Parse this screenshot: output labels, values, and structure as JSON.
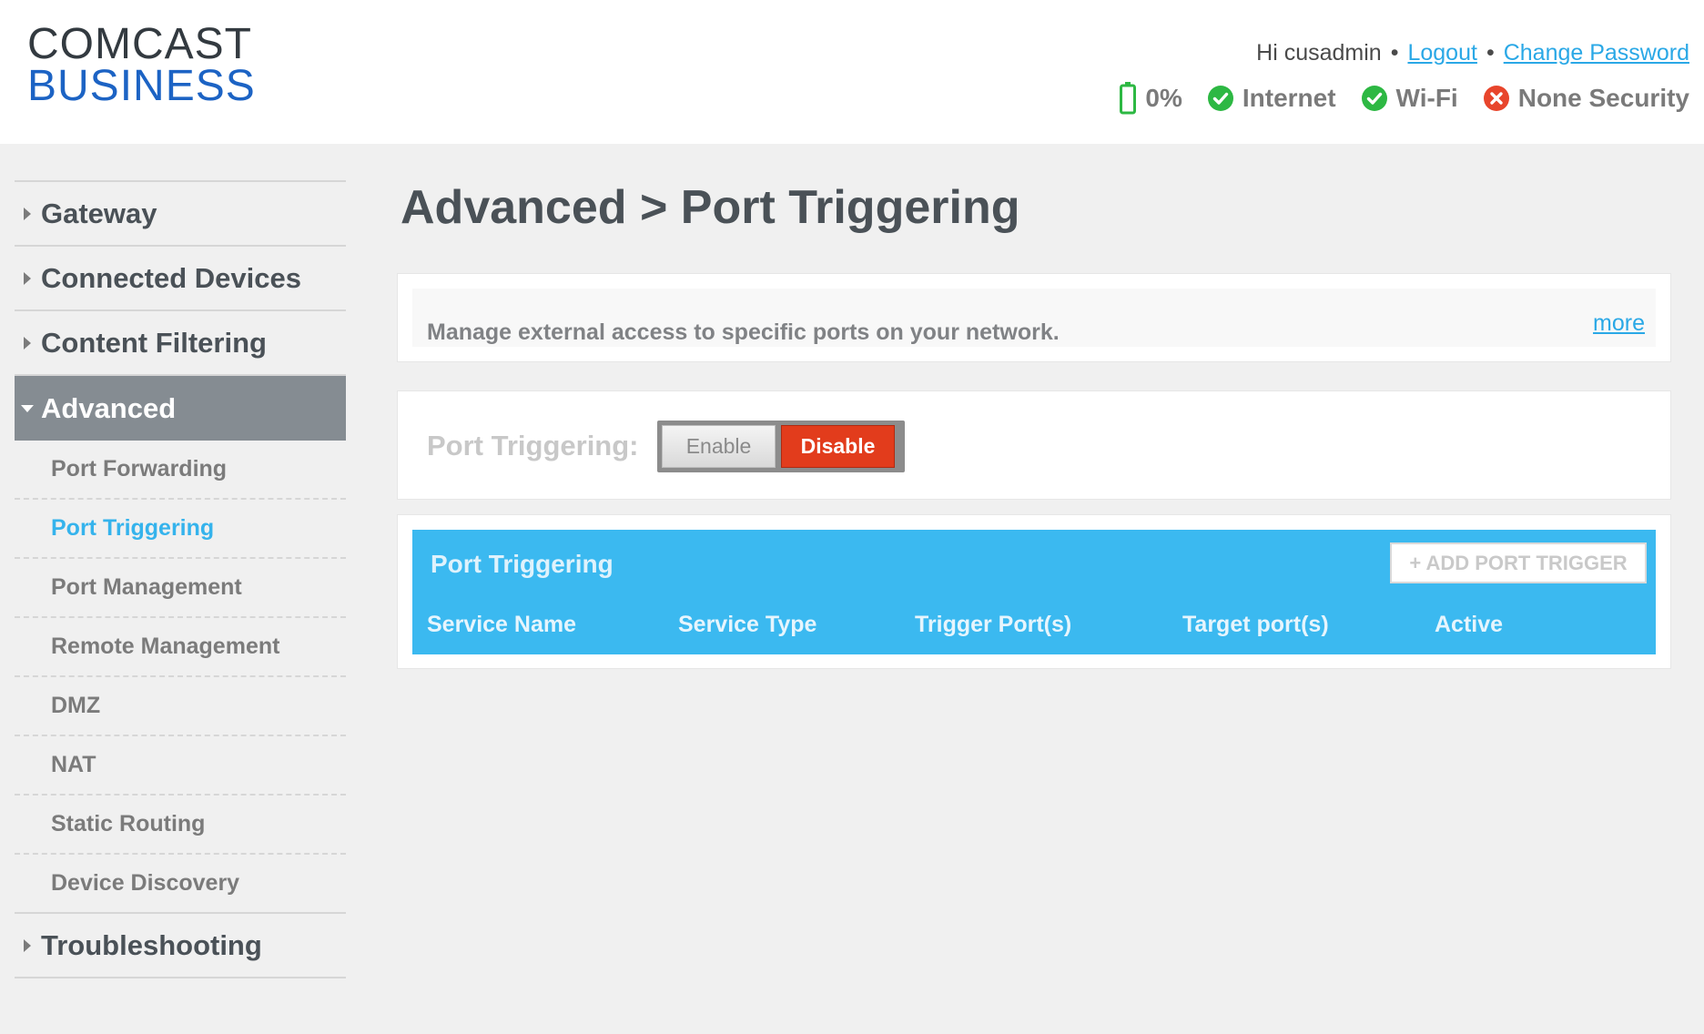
{
  "header": {
    "logo_line1": "COMCAST",
    "logo_line2": "BUSINESS",
    "greeting": "Hi cusadmin",
    "separator": "•",
    "logout_label": "Logout",
    "change_password_label": "Change Password",
    "status": {
      "battery_label": "0%",
      "internet_label": "Internet",
      "wifi_label": "Wi-Fi",
      "security_label": "None Security"
    }
  },
  "sidebar": {
    "items": [
      {
        "label": "Gateway"
      },
      {
        "label": "Connected Devices"
      },
      {
        "label": "Content Filtering"
      },
      {
        "label": "Advanced"
      },
      {
        "label": "Troubleshooting"
      }
    ],
    "advanced_subitems": [
      {
        "label": "Port Forwarding"
      },
      {
        "label": "Port Triggering"
      },
      {
        "label": "Port Management"
      },
      {
        "label": "Remote Management"
      },
      {
        "label": "DMZ"
      },
      {
        "label": "NAT"
      },
      {
        "label": "Static Routing"
      },
      {
        "label": "Device Discovery"
      }
    ]
  },
  "main": {
    "title": "Advanced > Port Triggering",
    "info_text": "Manage external access to specific ports on your network.",
    "more_label": "more",
    "toggle": {
      "label": "Port Triggering:",
      "enable_label": "Enable",
      "disable_label": "Disable",
      "selected": "Disable"
    },
    "table": {
      "title": "Port Triggering",
      "add_button_label": "+ ADD PORT TRIGGER",
      "columns": [
        "Service Name",
        "Service Type",
        "Trigger Port(s)",
        "Target port(s)",
        "Active"
      ],
      "rows": []
    }
  },
  "colors": {
    "accent": "#3bb9f0",
    "disable_red": "#e23c1c",
    "status_ok": "#2db843",
    "status_error": "#e8452c",
    "active_nav": "#858c92",
    "brand_blue": "#1c63c4"
  },
  "icons": {
    "battery": "battery-icon",
    "internet": "check-circle-icon",
    "wifi": "check-circle-icon",
    "security": "x-circle-icon",
    "nav_collapsed": "triangle-right-icon",
    "nav_expanded": "triangle-down-icon"
  }
}
